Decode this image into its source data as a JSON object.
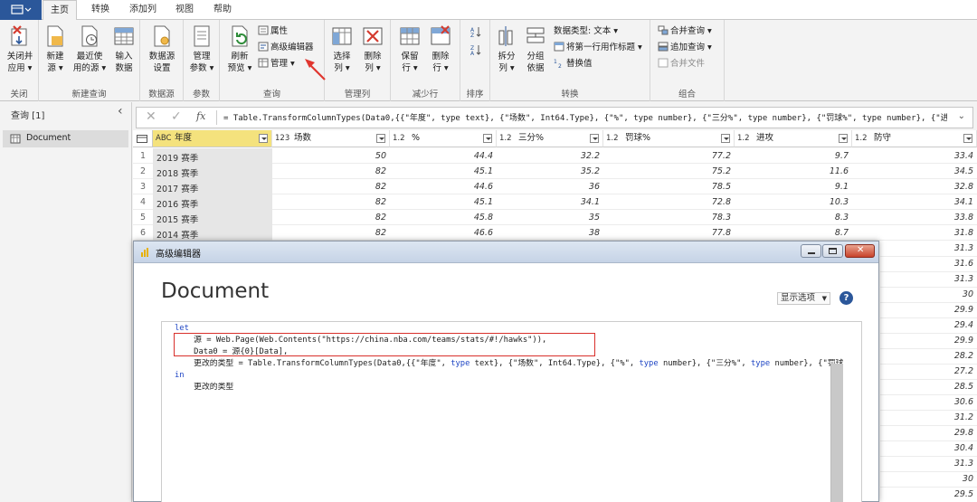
{
  "tabs": [
    {
      "label": "主页",
      "active": true
    },
    {
      "label": "转换",
      "active": false
    },
    {
      "label": "添加列",
      "active": false
    },
    {
      "label": "视图",
      "active": false
    },
    {
      "label": "帮助",
      "active": false
    }
  ],
  "ribbon": {
    "groups": {
      "close": "关闭",
      "new_query": "新建查询",
      "data_source": "数据源",
      "params": "参数",
      "query": "查询",
      "manage_cols": "管理列",
      "reduce_rows": "减少行",
      "sort": "排序",
      "transform": "转换",
      "combine": "组合"
    },
    "buttons": {
      "close_apply_1": "关闭并",
      "close_apply_2": "应用 ▾",
      "new_source_1": "新建",
      "new_source_2": "源 ▾",
      "recent_1": "最近使",
      "recent_2": "用的源 ▾",
      "enter_1": "输入",
      "enter_2": "数据",
      "ds_settings_1": "数据源",
      "ds_settings_2": "设置",
      "manage_params_1": "管理",
      "manage_params_2": "参数 ▾",
      "refresh_1": "刷新",
      "refresh_2": "预览 ▾",
      "properties": "属性",
      "advanced_editor": "高级编辑器",
      "manage": "管理 ▾",
      "choose_cols_1": "选择",
      "choose_cols_2": "列 ▾",
      "remove_cols_1": "删除",
      "remove_cols_2": "列 ▾",
      "keep_rows_1": "保留",
      "keep_rows_2": "行 ▾",
      "remove_rows_1": "删除",
      "remove_rows_2": "行 ▾",
      "split_1": "拆分",
      "split_2": "列 ▾",
      "group_1": "分组",
      "group_2": "依据",
      "data_type": "数据类型: 文本 ▾",
      "first_row": "将第一行用作标题 ▾",
      "replace": "替换值",
      "merge": "合并查询 ▾",
      "append": "追加查询 ▾",
      "combine_files": "合并文件"
    }
  },
  "queries_pane": {
    "title": "查询 [1]",
    "collapse": "‹",
    "items": [
      "Document"
    ]
  },
  "formula_bar": {
    "fx": "fx",
    "formula": "= Table.TransformColumnTypes(Data0,{{\"年度\", type text}, {\"场数\", Int64.Type}, {\"%\", type number}, {\"三分%\", type number}, {\"罚球%\", type number}, {\"进"
  },
  "grid": {
    "columns": [
      {
        "type": "ABC",
        "name": "年度"
      },
      {
        "type": "123",
        "name": "场数"
      },
      {
        "type": "1.2",
        "name": "%"
      },
      {
        "type": "1.2",
        "name": "三分%"
      },
      {
        "type": "1.2",
        "name": "罚球%"
      },
      {
        "type": "1.2",
        "name": "进攻"
      },
      {
        "type": "1.2",
        "name": "防守"
      }
    ],
    "rows": [
      [
        "1",
        "2019 赛季",
        "50",
        "44.4",
        "32.2",
        "77.2",
        "9.7",
        "33.4"
      ],
      [
        "2",
        "2018 赛季",
        "82",
        "45.1",
        "35.2",
        "75.2",
        "11.6",
        "34.5"
      ],
      [
        "3",
        "2017 赛季",
        "82",
        "44.6",
        "36",
        "78.5",
        "9.1",
        "32.8"
      ],
      [
        "4",
        "2016 赛季",
        "82",
        "45.1",
        "34.1",
        "72.8",
        "10.3",
        "34.1"
      ],
      [
        "5",
        "2015 赛季",
        "82",
        "45.8",
        "35",
        "78.3",
        "8.3",
        "33.8"
      ],
      [
        "6",
        "2014 赛季",
        "82",
        "46.6",
        "38",
        "77.8",
        "8.7",
        "31.8"
      ]
    ],
    "extra_defense": [
      "31.3",
      "31.6",
      "31.3",
      "30",
      "29.9",
      "29.4",
      "29.9",
      "28.2",
      "27.2",
      "28.5",
      "30.6",
      "31.2",
      "29.8",
      "30.4",
      "31.3",
      "30",
      "29.5"
    ]
  },
  "dialog": {
    "title": "高级编辑器",
    "heading": "Document",
    "display_options": "显示选项",
    "help": "?",
    "code": {
      "l1": "let",
      "l2": "    源 = Web.Page(Web.Contents(\"https://china.nba.com/teams/stats/#!/hawks\")),",
      "l3": "    Data0 = 源{0}[Data],",
      "l4a": "    更改的类型 = Table.TransformColumnTypes(Data0,{{\"年度\", ",
      "l4b": "type",
      "l4c": " text}, {\"场数\", Int64.Type}, {\"%\", ",
      "l4d": "type",
      "l4e": " number}, {\"三分%\", ",
      "l4f": "type",
      "l4g": " number}, {\"罚球",
      "l5": "in",
      "l6": "    更改的类型"
    }
  },
  "colors": {
    "accent": "#2b579a",
    "highlight_box": "#d9302b",
    "arrow": "#e0362f"
  }
}
